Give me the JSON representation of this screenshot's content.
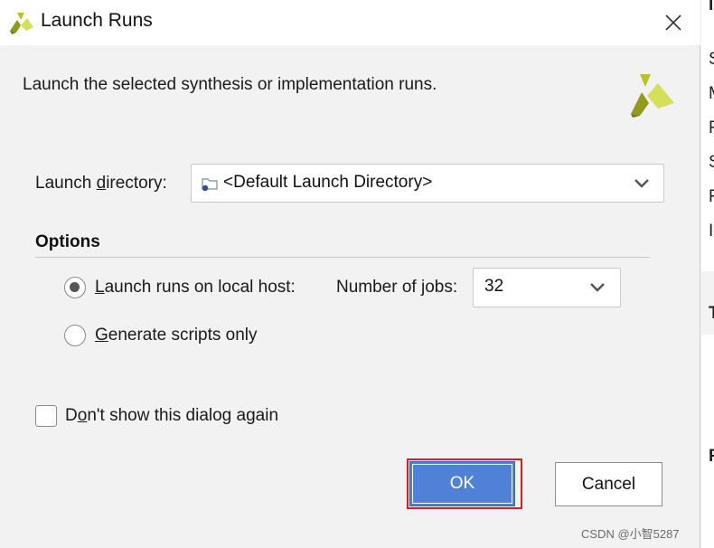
{
  "dialog": {
    "title": "Launch Runs",
    "description": "Launch the selected synthesis or implementation runs.",
    "launch_directory": {
      "label_pre": "Launch ",
      "label_mnemonic": "d",
      "label_post": "irectory:",
      "value": "<Default Launch Directory>"
    },
    "options": {
      "title": "Options",
      "local_host": {
        "label_mnemonic": "L",
        "label_rest": "aunch runs on local host:",
        "selected": true
      },
      "jobs": {
        "label": "Number of jobs:",
        "value": "32"
      },
      "scripts": {
        "label_mnemonic": "G",
        "label_rest": "enerate scripts only",
        "selected": false
      }
    },
    "dont_show": {
      "label_pre": "D",
      "label_mnemonic": "o",
      "label_post": "n't show this dialog again",
      "checked": false
    },
    "ok_label": "OK",
    "cancel_label": "Cancel"
  },
  "background": {
    "rows": [
      "In",
      "S",
      "M",
      "F",
      "S",
      "F",
      "I",
      "T",
      "F"
    ]
  },
  "watermark": "CSDN @小智5287",
  "colors": {
    "ok_button": "#4f82d6",
    "highlight_box": "#d0202a",
    "logo_dark": "#8f9a1f",
    "logo_light": "#d5e05a"
  }
}
